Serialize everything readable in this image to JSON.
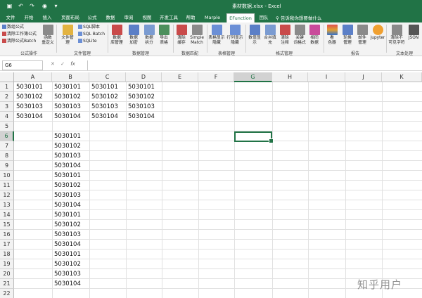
{
  "title": "素材数据.xlsx - Excel",
  "quick_access": [
    "save-icon",
    "undo-icon",
    "redo-icon",
    "camera-icon",
    "customize-icon"
  ],
  "tabs": [
    {
      "label": "文件"
    },
    {
      "label": "开始"
    },
    {
      "label": "插入"
    },
    {
      "label": "页面布局"
    },
    {
      "label": "公式"
    },
    {
      "label": "数据"
    },
    {
      "label": "审阅"
    },
    {
      "label": "视图"
    },
    {
      "label": "开发工具"
    },
    {
      "label": "帮助"
    },
    {
      "label": "Marple"
    },
    {
      "label": "EFunction",
      "active": true
    },
    {
      "label": "团队"
    }
  ],
  "tell_me": "告诉我你想要做什么",
  "ribbon": {
    "formula_ops": [
      "数组公式",
      "清除工作簿公式",
      "清除公式Batch"
    ],
    "formula_group": "公式操作",
    "func_label": [
      "函数",
      "重定义"
    ],
    "file_mgmt": [
      "文件管",
      "理"
    ],
    "sql_items": [
      "SQL脚本",
      "SQL Batch",
      "SQLite"
    ],
    "file_group": "文件管理",
    "data_mgmt": [
      [
        "数据",
        "库管理"
      ],
      [
        "数据",
        "加密"
      ],
      [
        "数据",
        "拆分"
      ],
      [
        "导出",
        "表格"
      ]
    ],
    "data_group": "数据管理",
    "match": [
      [
        "清除",
        "缓存"
      ],
      [
        "Simple",
        "Match"
      ]
    ],
    "match_group": "数据匹配",
    "table_mgmt": [
      [
        "表格显示",
        "隐藏"
      ],
      [
        "行列显示",
        "隐藏"
      ]
    ],
    "table_group": "表格管理",
    "format_mgmt": [
      [
        "数值显",
        "示"
      ],
      [
        "合并填",
        "充"
      ],
      [
        "清除",
        "注释"
      ],
      [
        "关键",
        "词格式"
      ],
      [
        "相同",
        "数据"
      ]
    ],
    "format_group": "格式管理",
    "report": [
      [
        "看",
        "色器"
      ],
      [
        "轮换",
        "管理"
      ],
      [
        "邮件",
        "管理"
      ],
      [
        "jupyter",
        ""
      ]
    ],
    "report_group": "报告",
    "text_proc": [
      [
        "清除不",
        "可见字符"
      ],
      [
        "JSON",
        ""
      ]
    ],
    "text_group": "文本处理"
  },
  "formula_bar": {
    "name_box": "G6",
    "cancel": "✕",
    "enter": "✓",
    "fx": "fx",
    "value": ""
  },
  "columns": [
    "A",
    "B",
    "C",
    "D",
    "E",
    "F",
    "G",
    "H",
    "I",
    "J",
    "K"
  ],
  "selected_column": "G",
  "selected_row": "6",
  "rows": [
    "1",
    "2",
    "3",
    "4",
    "5",
    "6",
    "7",
    "8",
    "9",
    "10",
    "11",
    "12",
    "13",
    "14",
    "15",
    "16",
    "17",
    "18",
    "19",
    "20",
    "21",
    "22"
  ],
  "cells": {
    "A": [
      "5030101",
      "5030102",
      "5030103",
      "5030104"
    ],
    "B_top": [
      "5030101",
      "5030102",
      "5030103",
      "5030104"
    ],
    "C": [
      "5030101",
      "5030102",
      "5030103",
      "5030104"
    ],
    "D": [
      "5030101",
      "5030102",
      "5030103",
      "5030104"
    ],
    "B_list": [
      "5030101",
      "5030102",
      "5030103",
      "5030104",
      "5030101",
      "5030102",
      "5030103",
      "5030104",
      "5030101",
      "5030102",
      "5030103",
      "5030104",
      "5030101",
      "5030102",
      "5030103",
      "5030104"
    ]
  },
  "watermark": "知乎用户",
  "colors": {
    "excel_green": "#217346",
    "ribbon_bg": "#f3f3f3",
    "header_bg": "#f2f2f2"
  }
}
